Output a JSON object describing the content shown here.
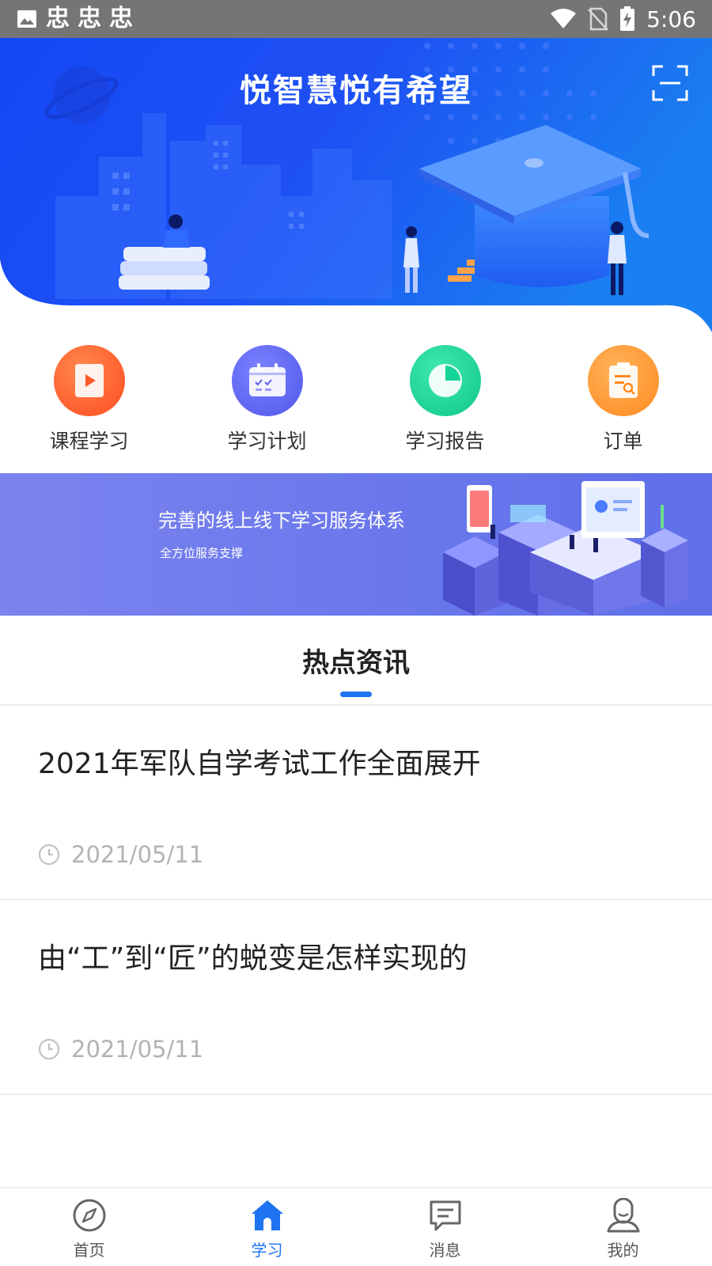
{
  "status_bar": {
    "time": "5:06",
    "notification_icons": [
      "image-icon",
      "bug-icon",
      "bug-icon",
      "bug-icon"
    ],
    "bug_glyph": "忠",
    "system_icons": [
      "wifi-icon",
      "no-sim-icon",
      "battery-charging-icon"
    ]
  },
  "header": {
    "title": "悦智慧悦有希望",
    "scan_icon": "scan-icon"
  },
  "actions": [
    {
      "label": "课程学习",
      "icon": "course-icon",
      "color": "#ff5a2a"
    },
    {
      "label": "学习计划",
      "icon": "calendar-icon",
      "color": "#5b60f0"
    },
    {
      "label": "学习报告",
      "icon": "pie-chart-icon",
      "color": "#16d39a"
    },
    {
      "label": "订单",
      "icon": "order-clipboard-icon",
      "color": "#ff8a20"
    }
  ],
  "promo": {
    "title": "完善的线上线下学习服务体系",
    "subtitle": "全方位服务支撑"
  },
  "news": {
    "title": "热点资讯",
    "items": [
      {
        "title": "2021年军队自学考试工作全面展开",
        "date": "2021/05/11"
      },
      {
        "title": "由“工”到“匠”的蜕变是怎样实现的",
        "date": "2021/05/11"
      }
    ]
  },
  "bottom_nav": [
    {
      "label": "首页",
      "icon": "compass-icon",
      "active": false
    },
    {
      "label": "学习",
      "icon": "home-icon",
      "active": true
    },
    {
      "label": "消息",
      "icon": "message-icon",
      "active": false
    },
    {
      "label": "我的",
      "icon": "profile-icon",
      "active": false
    }
  ],
  "colors": {
    "brand_blue": "#1e73f0",
    "hero_blue": "#1a4cf2",
    "promo_purple": "#6a78ec",
    "date_gray": "#b3b3b3"
  }
}
